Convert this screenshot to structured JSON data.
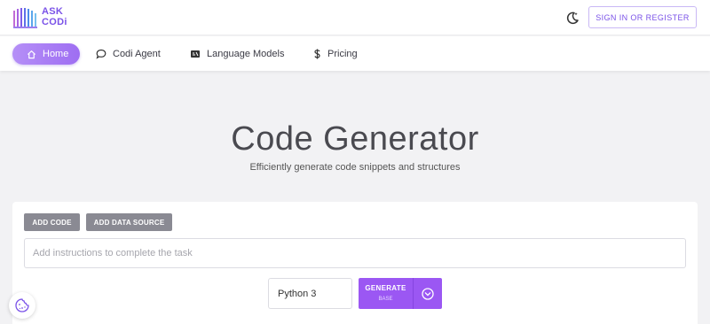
{
  "brand": {
    "logo_line1": "ASK",
    "logo_line2": "CODi",
    "accent": "#7a52e8"
  },
  "header": {
    "theme_toggle_icon": "moon-icon",
    "signin_label": "SIGN IN OR REGISTER"
  },
  "nav": {
    "items": [
      {
        "label": "Home",
        "icon": "home-icon",
        "active": true
      },
      {
        "label": "Codi Agent",
        "icon": "chat-icon",
        "active": false
      },
      {
        "label": "Language Models",
        "icon": "models-icon",
        "active": false
      },
      {
        "label": "Pricing",
        "icon": "dollar-icon",
        "active": false
      }
    ]
  },
  "hero": {
    "title": "Code Generator",
    "subtitle": "Efficiently generate code snippets and structures"
  },
  "form": {
    "add_code_label": "ADD CODE",
    "add_data_source_label": "ADD DATA SOURCE",
    "instructions_placeholder": "Add instructions to complete the task",
    "instructions_value": "",
    "language_value": "Python 3",
    "generate_label": "GENERATE",
    "generate_sub_label": "BASE",
    "generate_color": "#9b57f3"
  },
  "widgets": {
    "cookie_icon": "cookie-icon"
  }
}
